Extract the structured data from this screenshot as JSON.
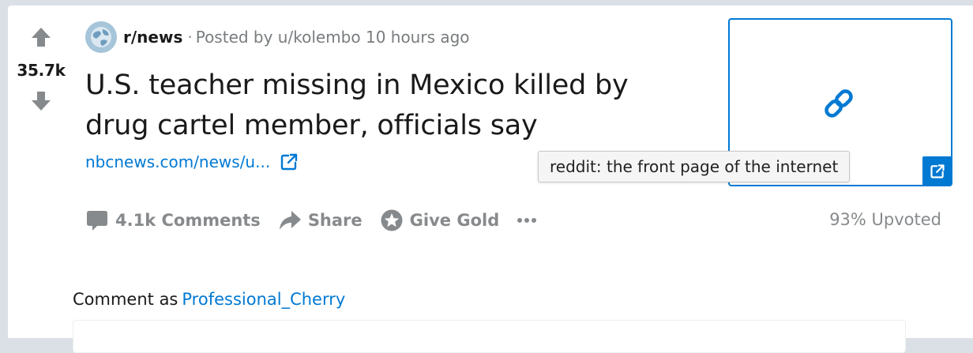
{
  "post": {
    "score": "35.7k",
    "subreddit": "r/news",
    "separator": "·",
    "posted_by": "Posted by u/kolembo 10 hours ago",
    "title": "U.S. teacher missing in Mexico killed by drug cartel member, officials say",
    "link_text": "nbcnews.com/news/u...",
    "tooltip": "reddit: the front page of the internet",
    "upvoted": "93% Upvoted"
  },
  "actions": {
    "comments": "4.1k Comments",
    "share": "Share",
    "give_gold": "Give Gold"
  },
  "comment_box": {
    "label": "Comment as",
    "username": "Professional_Cherry"
  },
  "colors": {
    "accent": "#0079d3",
    "muted": "#878a8c",
    "text": "#1a1a1b",
    "page_bg": "#dae0e6"
  },
  "icons": [
    "upvote-arrow-icon",
    "downvote-arrow-icon",
    "subreddit-globe-icon",
    "external-link-icon",
    "link-chain-icon",
    "comment-bubble-icon",
    "share-arrow-icon",
    "gold-star-icon",
    "more-dots-icon"
  ]
}
